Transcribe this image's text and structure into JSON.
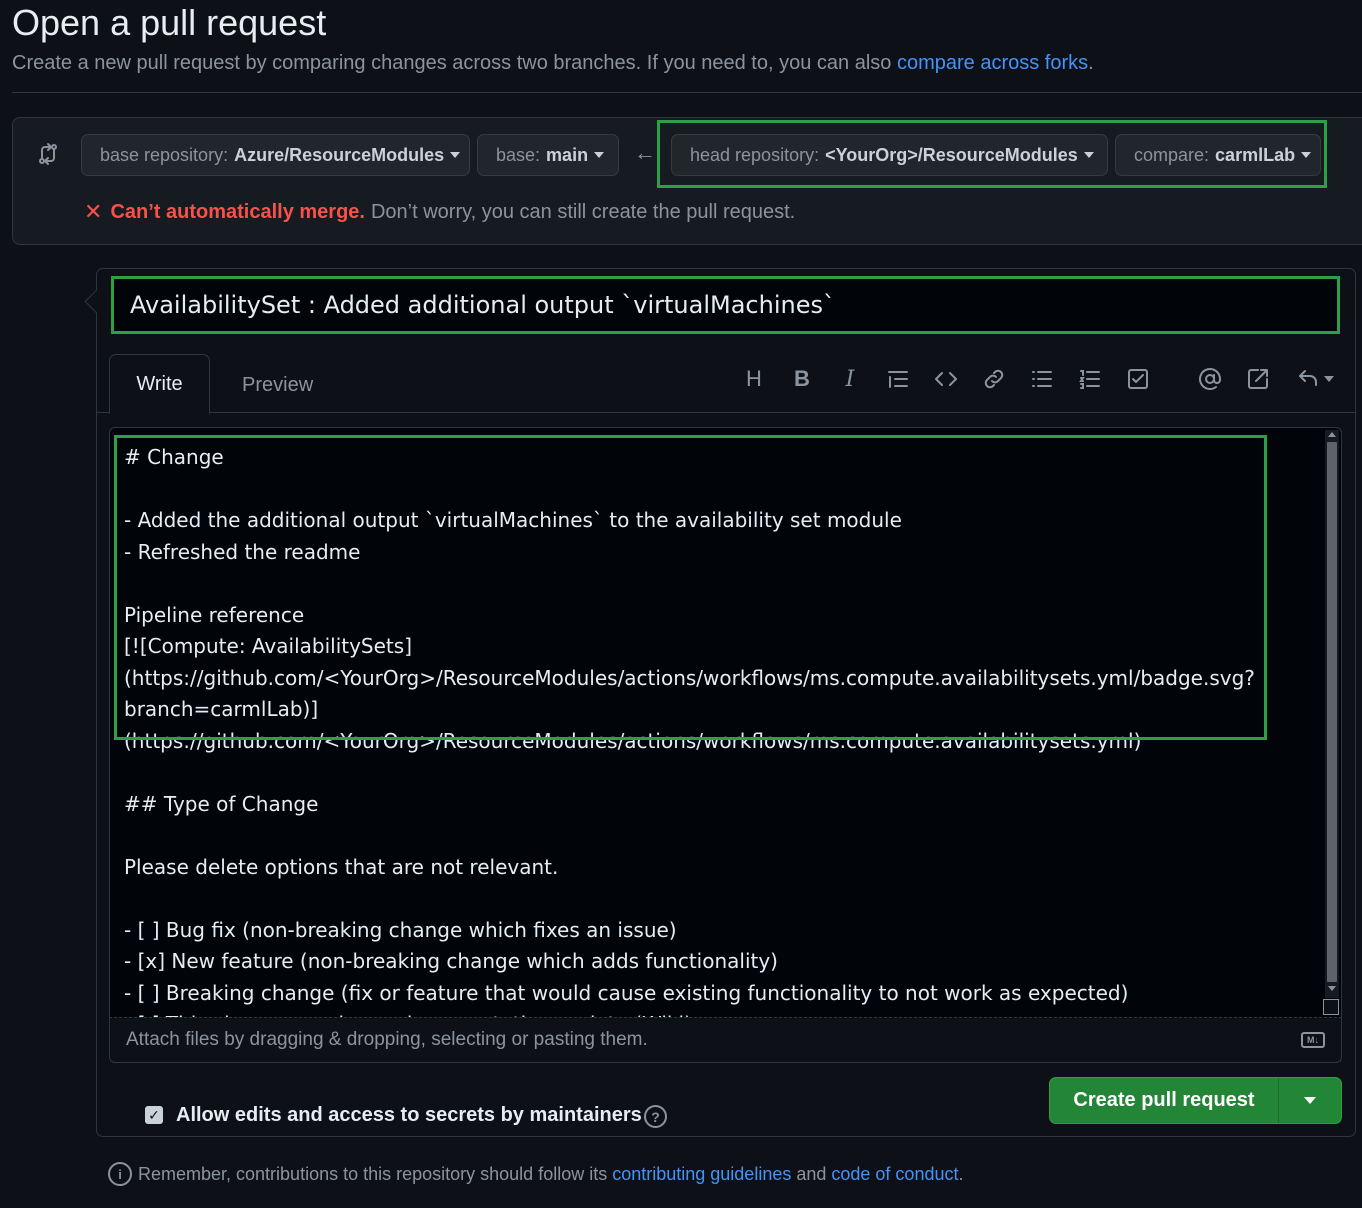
{
  "header": {
    "title": "Open a pull request",
    "subtitle": "Create a new pull request by comparing changes across two branches. If you need to, you can also",
    "subtitle_link": "compare across forks",
    "subtitle_end": "."
  },
  "range": {
    "base_repo_label": "base repository:",
    "base_repo_value": "Azure/ResourceModules",
    "base_label": "base:",
    "base_value": "main",
    "head_repo_label": "head repository:",
    "head_repo_value": "<YourOrg>/ResourceModules",
    "compare_label": "compare:",
    "compare_value": "carmlLab",
    "merge_error": "Can’t automatically merge.",
    "merge_message": "Don’t worry, you can still create the pull request."
  },
  "form": {
    "title_value": "AvailabilitySet : Added additional output `virtualMachines`",
    "tabs": {
      "write": "Write",
      "preview": "Preview"
    },
    "toolbar": [
      "heading-icon",
      "bold-icon",
      "italic-icon",
      "quote-icon",
      "code-icon",
      "link-icon",
      "unordered-list-icon",
      "ordered-list-icon",
      "task-list-icon",
      "mention-icon",
      "reference-icon",
      "reply-icon"
    ],
    "body": "# Change\n\n- Added the additional output `virtualMachines` to the availability set module\n- Refreshed the readme\n\nPipeline reference\n[![Compute: AvailabilitySets]\n(https://github.com/<YourOrg>/ResourceModules/actions/workflows/ms.compute.availabilitysets.yml/badge.svg?\nbranch=carmlLab)](https://github.com/<YourOrg>/ResourceModules/actions/workflows/ms.compute.availabilitysets.yml)\n\n## Type of Change\n\nPlease delete options that are not relevant.\n\n- [ ] Bug fix (non-breaking change which fixes an issue)\n- [x] New feature (non-breaking change which adds functionality)\n- [ ] Breaking change (fix or feature that would cause existing functionality to not work as expected)\n- [ ] This change requires a documentation update (Wiki)",
    "attach_text": "Attach files by dragging & dropping, selecting or pasting them.",
    "markdown_badge": "M↓",
    "allow_edits_label": "Allow edits and access to secrets by maintainers",
    "allow_edits_checked": true,
    "create_button": "Create pull request"
  },
  "footer": {
    "text_start": "Remember, contributions to this repository should follow its",
    "link1": "contributing guidelines",
    "text_mid": "and",
    "link2": "code of conduct",
    "text_end": "."
  },
  "colors": {
    "background": "#0d1117",
    "accent_green": "#238636",
    "highlight_green": "#2ea043",
    "link_blue": "#4493f8",
    "error_red": "#f85149"
  }
}
